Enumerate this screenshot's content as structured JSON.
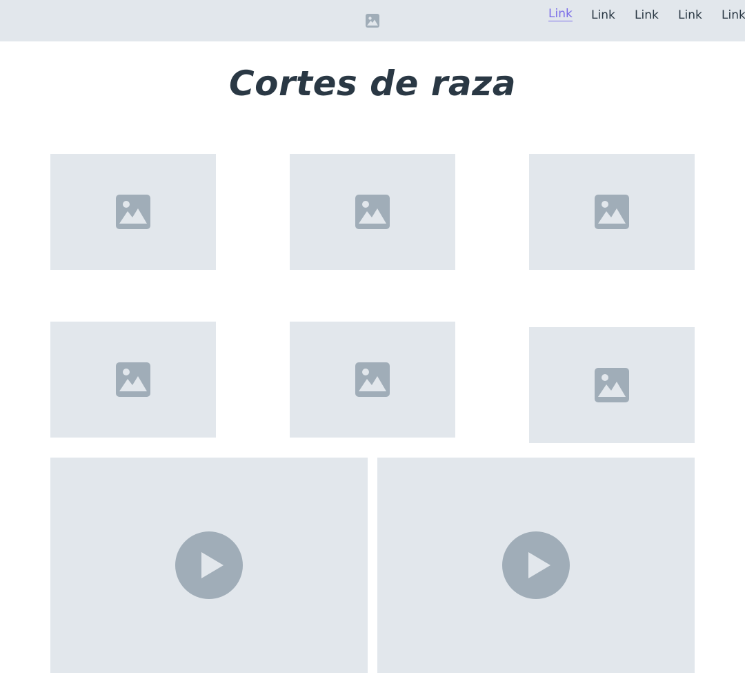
{
  "nav": {
    "logo_icon": "image-icon",
    "links": [
      "Link",
      "Link",
      "Link",
      "Link",
      "Link"
    ],
    "active_index": 0,
    "active_color": "#7b6ee8"
  },
  "page": {
    "title": "Cortes de raza"
  },
  "gallery": {
    "images": [
      {
        "icon": "image-placeholder-icon"
      },
      {
        "icon": "image-placeholder-icon"
      },
      {
        "icon": "image-placeholder-icon"
      },
      {
        "icon": "image-placeholder-icon"
      },
      {
        "icon": "image-placeholder-icon"
      },
      {
        "icon": "image-placeholder-icon"
      }
    ],
    "videos": [
      {
        "icon": "play-icon"
      },
      {
        "icon": "play-icon"
      }
    ]
  },
  "colors": {
    "placeholder_bg": "#e2e7ec",
    "placeholder_icon": "#a0adb8",
    "text": "#2a3844"
  }
}
